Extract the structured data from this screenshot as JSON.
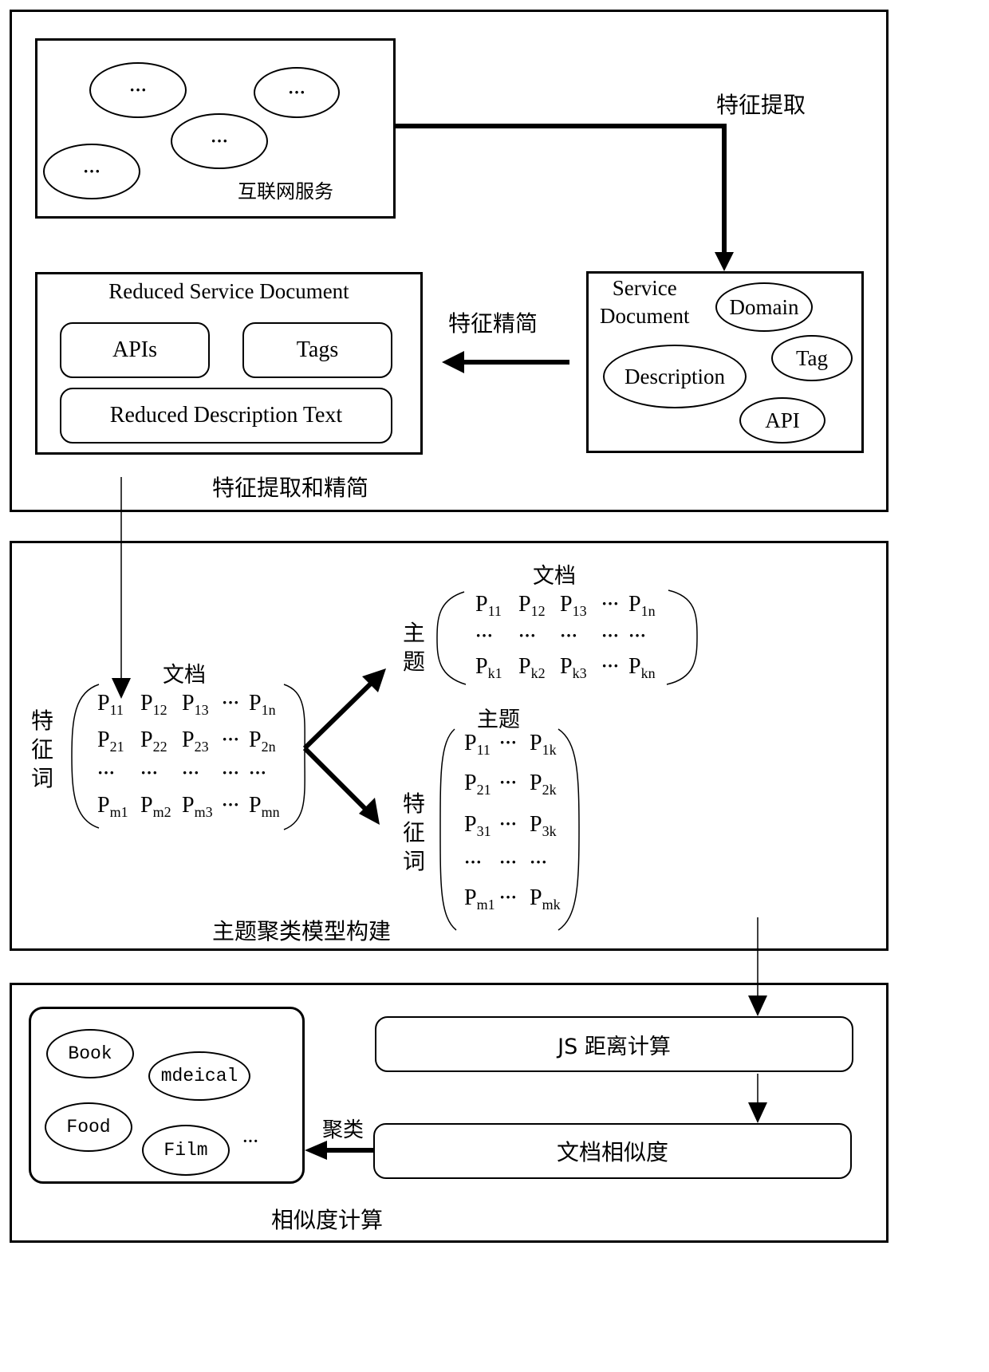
{
  "panel1": {
    "caption": "特征提取和精简",
    "internet_services": {
      "label": "互联网服务",
      "ellipses": [
        "···",
        "···",
        "···",
        "···"
      ]
    },
    "extract_label": "特征提取",
    "reduce_label": "特征精简",
    "service_document": {
      "title_line1": "Service",
      "title_line2": "Document",
      "items": [
        "Domain",
        "Tag",
        "Description",
        "API"
      ]
    },
    "reduced_document": {
      "title": "Reduced Service Document",
      "items": [
        "APIs",
        "Tags",
        "Reduced Description Text"
      ]
    }
  },
  "panel2": {
    "caption": "主题聚类模型构建",
    "doc_word_matrix": {
      "col_label": "文档",
      "row_label": [
        "特",
        "征",
        "词"
      ],
      "rows": [
        [
          [
            "P",
            "11"
          ],
          [
            "P",
            "12"
          ],
          [
            "P",
            "13"
          ],
          [
            "···",
            ""
          ],
          [
            "P",
            "1n"
          ]
        ],
        [
          [
            "P",
            "21"
          ],
          [
            "P",
            "22"
          ],
          [
            "P",
            "23"
          ],
          [
            "···",
            ""
          ],
          [
            "P",
            "2n"
          ]
        ],
        [
          [
            "···",
            ""
          ],
          [
            "···",
            ""
          ],
          [
            "···",
            ""
          ],
          [
            "···",
            ""
          ],
          [
            "···",
            ""
          ]
        ],
        [
          [
            "P",
            "m1"
          ],
          [
            "P",
            "m2"
          ],
          [
            "P",
            "m3"
          ],
          [
            "···",
            ""
          ],
          [
            "P",
            "mn"
          ]
        ]
      ]
    },
    "topic_doc_matrix": {
      "col_label": "文档",
      "row_label": [
        "主",
        "题"
      ],
      "rows": [
        [
          [
            "P",
            "11"
          ],
          [
            "P",
            "12"
          ],
          [
            "P",
            "13"
          ],
          [
            "···",
            ""
          ],
          [
            "P",
            "1n"
          ]
        ],
        [
          [
            "···",
            ""
          ],
          [
            "···",
            ""
          ],
          [
            "···",
            ""
          ],
          [
            "···",
            ""
          ],
          [
            "···",
            ""
          ]
        ],
        [
          [
            "P",
            "k1"
          ],
          [
            "P",
            "k2"
          ],
          [
            "P",
            "k3"
          ],
          [
            "···",
            ""
          ],
          [
            "P",
            "kn"
          ]
        ]
      ]
    },
    "word_topic_matrix": {
      "col_label": "主题",
      "row_label": [
        "特",
        "征",
        "词"
      ],
      "rows": [
        [
          [
            "P",
            "11"
          ],
          [
            "···",
            ""
          ],
          [
            "P",
            "1k"
          ]
        ],
        [
          [
            "P",
            "21"
          ],
          [
            "···",
            ""
          ],
          [
            "P",
            "2k"
          ]
        ],
        [
          [
            "P",
            "31"
          ],
          [
            "···",
            ""
          ],
          [
            "P",
            "3k"
          ]
        ],
        [
          [
            "···",
            ""
          ],
          [
            "···",
            ""
          ],
          [
            "···",
            ""
          ]
        ],
        [
          [
            "P",
            "m1"
          ],
          [
            "···",
            ""
          ],
          [
            "P",
            "mk"
          ]
        ]
      ]
    }
  },
  "panel3": {
    "caption": "相似度计算",
    "js_distance": "JS 距离计算",
    "doc_similarity": "文档相似度",
    "cluster_label": "聚类",
    "clusters": [
      "Book",
      "mdeical",
      "Food",
      "Film"
    ],
    "more": "···"
  }
}
